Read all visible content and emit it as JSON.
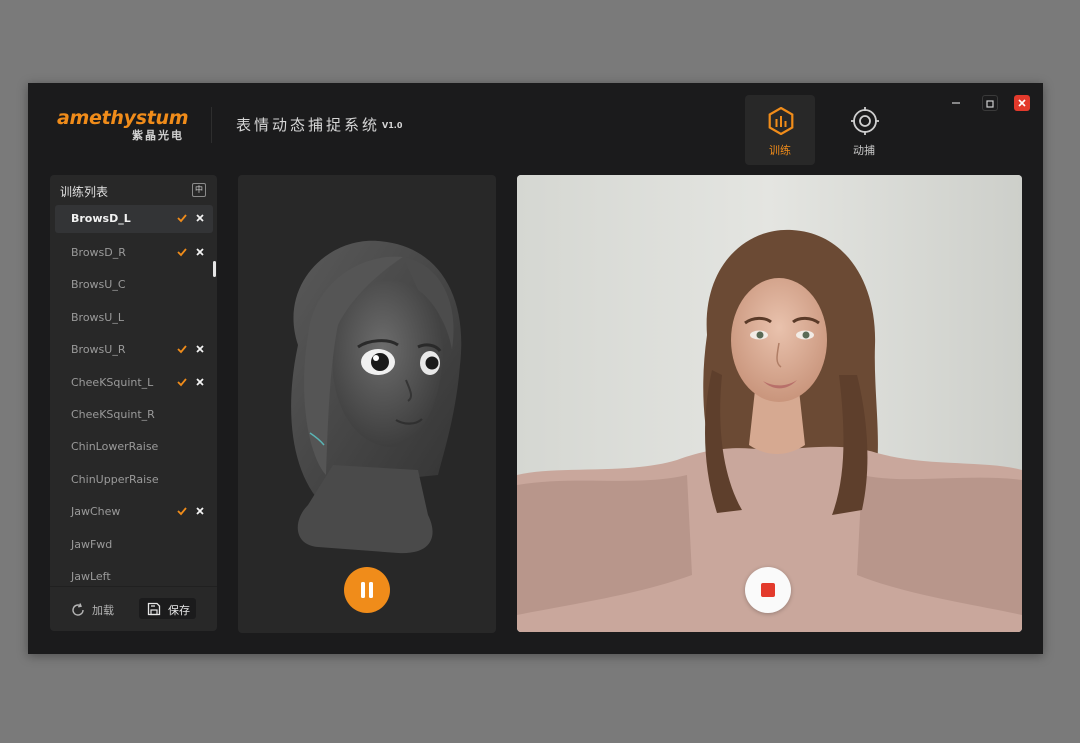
{
  "brand": {
    "logo_text": "amethystum",
    "logo_subtitle": "紫晶光电"
  },
  "app": {
    "title": "表情动态捕捉系统",
    "version": "V1.0"
  },
  "mode_tabs": [
    {
      "label": "训练",
      "icon": "training-chart-icon",
      "active": true
    },
    {
      "label": "动捕",
      "icon": "target-icon",
      "active": false
    }
  ],
  "window_controls": [
    "minimize-icon",
    "maximize-icon",
    "close-icon"
  ],
  "sidebar": {
    "title": "训练列表",
    "lang_toggle": "中",
    "items": [
      {
        "label": "BrowsD_L",
        "trained": true,
        "selected": true
      },
      {
        "label": "BrowsD_R",
        "trained": true
      },
      {
        "label": "BrowsU_C",
        "trained": false
      },
      {
        "label": "BrowsU_L",
        "trained": false
      },
      {
        "label": "BrowsU_R",
        "trained": true
      },
      {
        "label": "CheeKSquint_L",
        "trained": true
      },
      {
        "label": "CheeKSquint_R",
        "trained": false
      },
      {
        "label": "ChinLowerRaise",
        "trained": false
      },
      {
        "label": "ChinUpperRaise",
        "trained": false
      },
      {
        "label": "JawChew",
        "trained": true
      },
      {
        "label": "JawFwd",
        "trained": false
      },
      {
        "label": "JawLeft",
        "trained": false
      }
    ],
    "load_label": "加载",
    "save_label": "保存"
  },
  "model_panel": {
    "control": "pause-icon"
  },
  "camera_panel": {
    "control": "stop-record-icon"
  },
  "colors": {
    "accent": "#f08c1a",
    "window_bg": "#1b1b1c",
    "panel_bg": "#282828",
    "close_red": "#e33a2c"
  }
}
